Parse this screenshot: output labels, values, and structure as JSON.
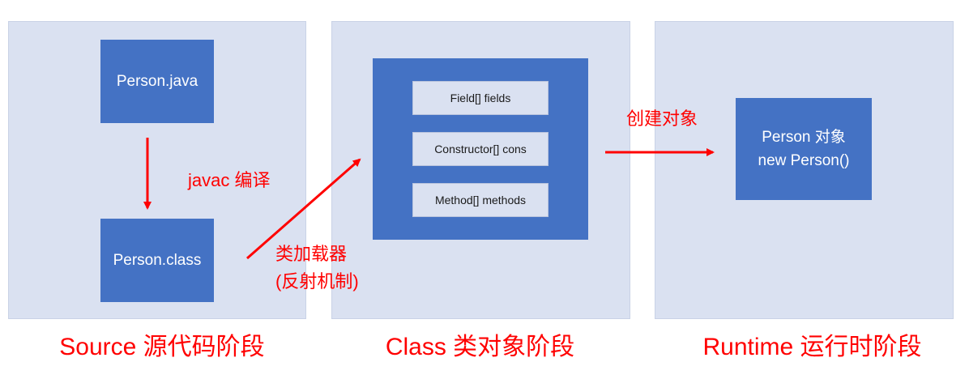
{
  "source": {
    "java_file": "Person.java",
    "class_file": "Person.class",
    "compile_label": "javac 编译",
    "stage_label": "Source 源代码阶段"
  },
  "class_stage": {
    "fields": "Field[] fields",
    "constructors": "Constructor[] cons",
    "methods": "Method[] methods",
    "loader_label_line1": "类加载器",
    "loader_label_line2": "(反射机制)",
    "stage_label": "Class 类对象阶段"
  },
  "runtime": {
    "create_label": "创建对象",
    "object_line1": "Person 对象",
    "object_line2": "new Person()",
    "stage_label": "Runtime 运行时阶段"
  },
  "colors": {
    "panel": "#dae1f1",
    "box": "#4472c4",
    "arrow": "#ff0000",
    "label": "#ff0000"
  }
}
